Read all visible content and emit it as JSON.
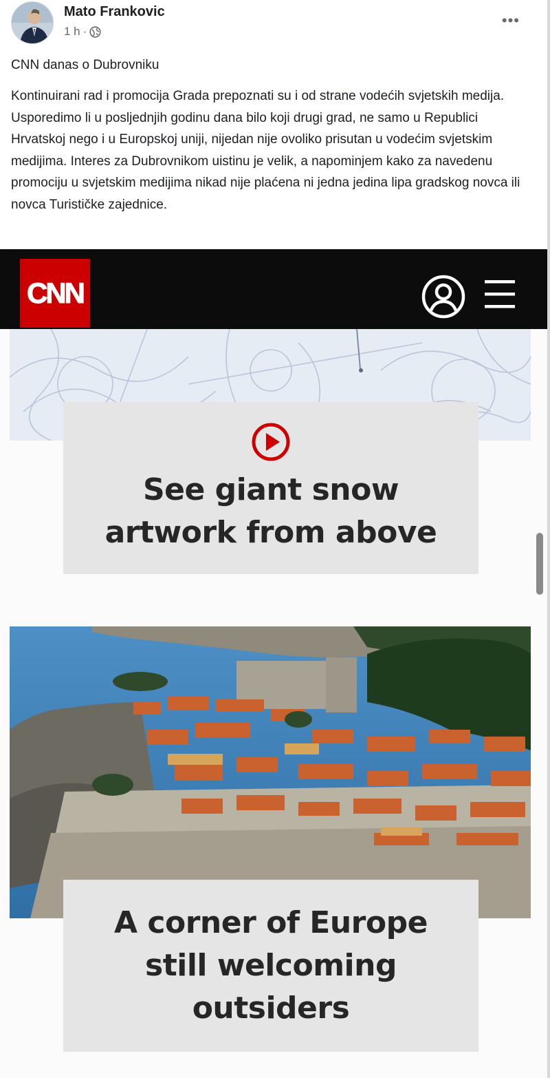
{
  "post": {
    "author": "Mato Frankovic",
    "time": "1 h",
    "separator": "·",
    "more_label": "•••",
    "title": "CNN danas o Dubrovniku",
    "body": "Kontinuirani rad i promocija Grada prepoznati su i od strane vodećih svjetskih medija. Usporedimo li u posljednjih godinu dana bilo koji drugi grad, ne samo u Republici Hrvatskoj nego i u Europskoj uniji, nijedan nije ovoliko prisutan u vodećim svjetskim medijima. Interes za Dubrovnikom uistinu je velik, a napominjem kako za navedenu promociju u svjetskim medijima nikad nije plaćena ni jedna jedina lipa gradskog novca ili novca Turističke zajednice."
  },
  "cnn": {
    "logo_text": "CNN",
    "brand_color": "#cc0000",
    "account_icon": "account-icon",
    "menu_icon": "menu-icon"
  },
  "stories": [
    {
      "headline_line1": "See giant snow",
      "headline_line2": "artwork from above",
      "icon": "play-icon",
      "accent": "#cc0000"
    },
    {
      "headline_line1": "A corner of Europe",
      "headline_line2": "still welcoming",
      "headline_line3": "outsiders"
    }
  ]
}
